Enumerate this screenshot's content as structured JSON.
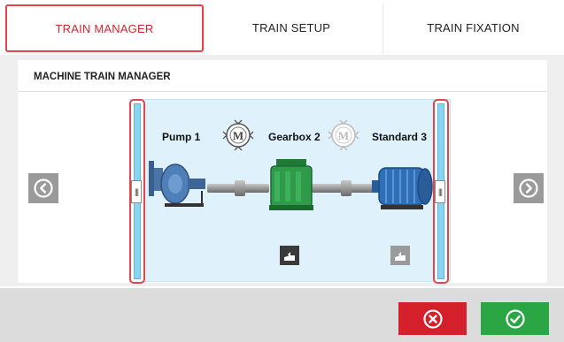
{
  "tabs": [
    {
      "label": "TRAIN MANAGER",
      "active": true
    },
    {
      "label": "TRAIN SETUP",
      "active": false
    },
    {
      "label": "TRAIN FIXATION",
      "active": false
    }
  ],
  "panel": {
    "title": "MACHINE TRAIN MANAGER"
  },
  "machines": [
    {
      "label": "Pump 1",
      "icon": "pump-icon"
    },
    {
      "label": "Gearbox 2",
      "icon": "gearbox-icon"
    },
    {
      "label": "Standard 3",
      "icon": "motor-icon"
    }
  ],
  "couplings": [
    {
      "icon": "coupling-m-icon",
      "active": true
    },
    {
      "icon": "coupling-m-icon",
      "active": false
    }
  ],
  "colors": {
    "accent_red": "#d4262c",
    "panel_blue": "#dff2fb",
    "cancel": "#d3202a",
    "ok": "#2aa744"
  },
  "icons": {
    "prev": "chevron-left-icon",
    "next": "chevron-right-icon",
    "cancel": "close-circle-icon",
    "ok": "check-circle-icon",
    "action": "machine-action-icon"
  }
}
